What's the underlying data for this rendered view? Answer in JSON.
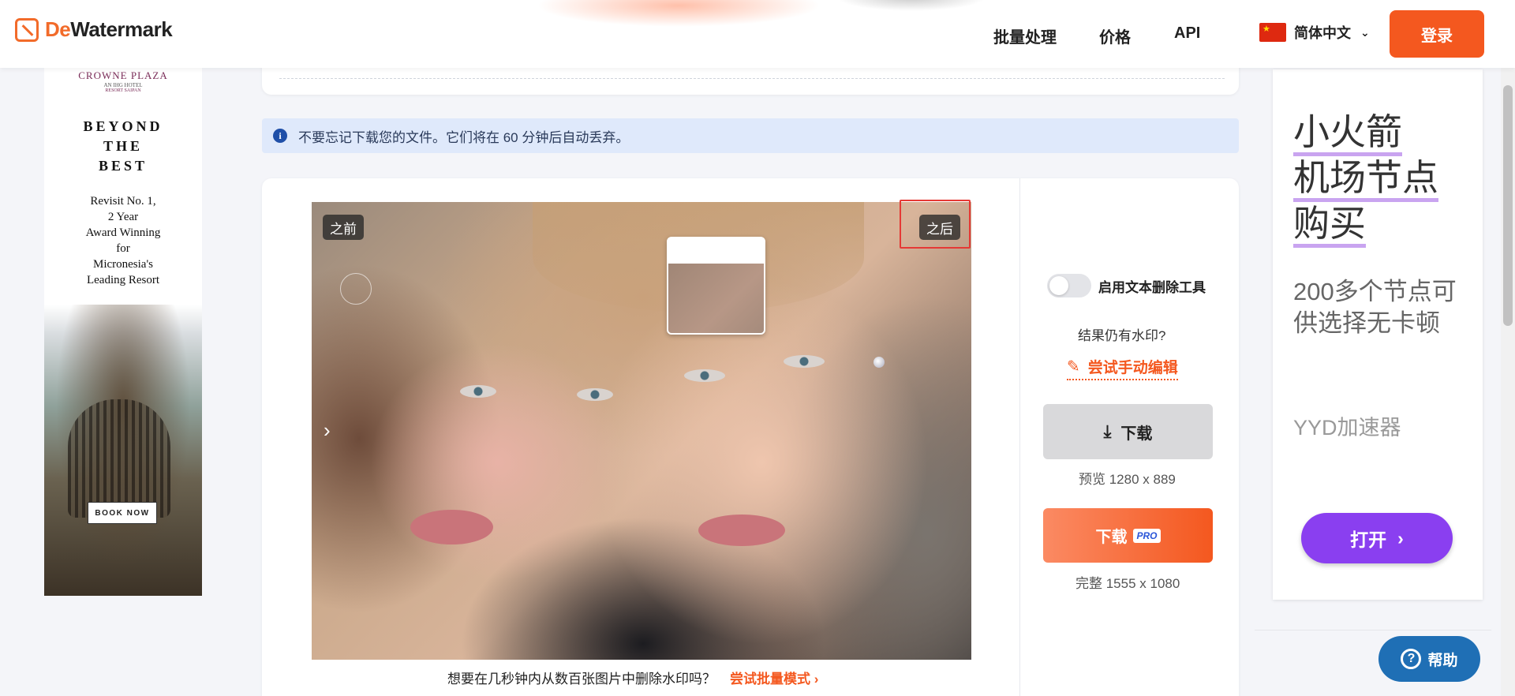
{
  "header": {
    "logo_prefix": "De",
    "logo_suffix": "Watermark",
    "nav": [
      "批量处理",
      "价格",
      "API"
    ],
    "language": "简体中文",
    "login": "登录"
  },
  "left_ad": {
    "brand": "CROWNE PLAZA",
    "brand_sub": "AN IHG HOTEL",
    "brand_loc": "RESORT SAIPAN",
    "headline": [
      "BEYOND",
      "THE",
      "BEST"
    ],
    "body": [
      "Revisit No. 1,",
      "2 Year",
      "Award Winning",
      "for",
      "Micronesia's",
      "Leading Resort"
    ],
    "cta": "BOOK NOW"
  },
  "info": {
    "icon": "i",
    "text": "不要忘记下载您的文件。它们将在 60 分钟后自动丢弃。"
  },
  "preview": {
    "before_label": "之前",
    "after_label": "之后"
  },
  "batch": {
    "text": "想要在几秒钟内从数百张图片中删除水印吗？",
    "link": "尝试批量模式",
    "link_chevron": "›"
  },
  "panel": {
    "toggle_label": "启用文本删除工具",
    "toggle_on": false,
    "still_watermark": "结果仍有水印?",
    "manual_edit": "尝试手动编辑",
    "download": "下载",
    "preview_size": "预览 1280 x 889",
    "pro_download": "下载",
    "pro_badge": "PRO",
    "full_size": "完整 1555 x 1080"
  },
  "right_ad": {
    "title": [
      "小火箭",
      "机场节点",
      "购买"
    ],
    "subtitle": "200多个节点可供选择无卡顿",
    "brand": "YYD加速器",
    "cta": "打开"
  },
  "help": {
    "label": "帮助",
    "icon": "?"
  },
  "colors": {
    "accent": "#f4581f",
    "info_bg": "#dfe9fb",
    "ad_button": "#8a3ff0",
    "help_button": "#1f6fb5"
  }
}
